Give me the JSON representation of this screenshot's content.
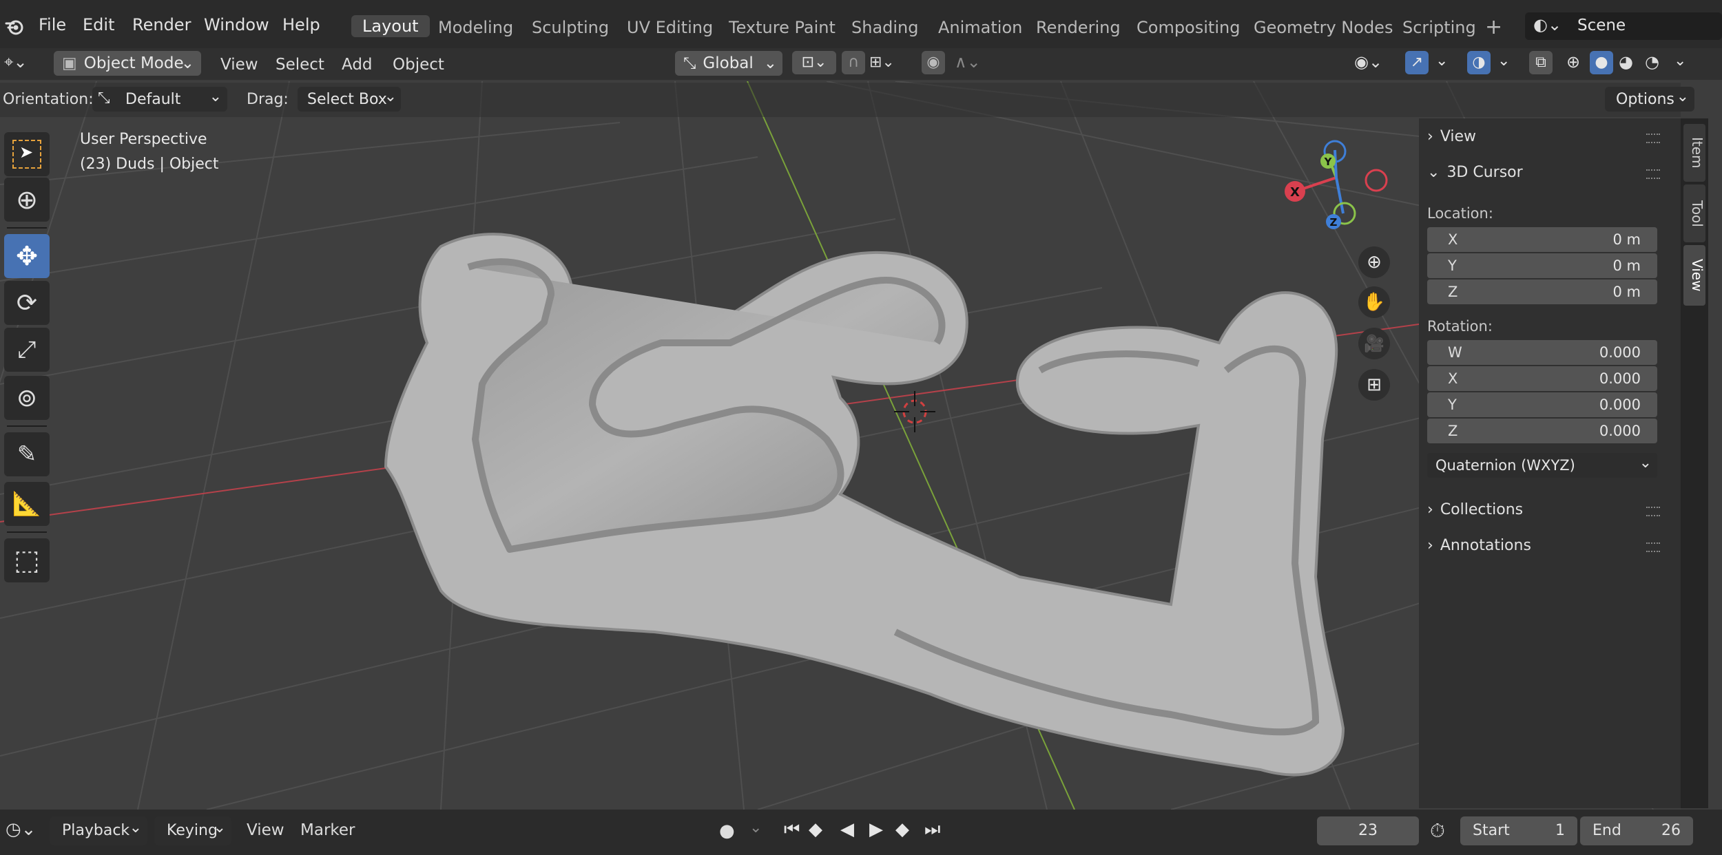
{
  "topbar": {
    "menus": [
      "File",
      "Edit",
      "Render",
      "Window",
      "Help"
    ],
    "workspaces": [
      "Layout",
      "Modeling",
      "Sculpting",
      "UV Editing",
      "Texture Paint",
      "Shading",
      "Animation",
      "Rendering",
      "Compositing",
      "Geometry Nodes",
      "Scripting"
    ],
    "active_workspace": "Layout",
    "add_tab": "+",
    "scene": "Scene"
  },
  "header": {
    "mode": "Object Mode",
    "menus": [
      "View",
      "Select",
      "Add",
      "Object"
    ],
    "transform_orientation": "Global"
  },
  "tool_settings": {
    "orientation_label": "Orientation:",
    "orientation_value": "Default",
    "drag_label": "Drag:",
    "drag_value": "Select Box",
    "options": "Options"
  },
  "viewport": {
    "perspective": "User Perspective",
    "object_info": "(23) Duds | Object",
    "gizmo": {
      "x": "X",
      "y": "Y",
      "z": "Z"
    }
  },
  "npanel": {
    "view_section": "View",
    "cursor_section": "3D Cursor",
    "location_label": "Location:",
    "location": [
      {
        "axis": "X",
        "value": "0 m"
      },
      {
        "axis": "Y",
        "value": "0 m"
      },
      {
        "axis": "Z",
        "value": "0 m"
      }
    ],
    "rotation_label": "Rotation:",
    "rotation": [
      {
        "axis": "W",
        "value": "0.000"
      },
      {
        "axis": "X",
        "value": "0.000"
      },
      {
        "axis": "Y",
        "value": "0.000"
      },
      {
        "axis": "Z",
        "value": "0.000"
      }
    ],
    "rotation_mode": "Quaternion (WXYZ)",
    "collections_section": "Collections",
    "annotations_section": "Annotations",
    "tabs": [
      "Item",
      "Tool",
      "View"
    ],
    "active_tab": "View"
  },
  "timeline": {
    "menus": [
      "Playback",
      "Keying",
      "View",
      "Marker"
    ],
    "current_frame": "23",
    "start_label": "Start",
    "start_value": "1",
    "end_label": "End",
    "end_value": "26"
  },
  "colors": {
    "accent": "#4772b3",
    "x_axis": "#d9404f",
    "y_axis": "#8bc34a",
    "z_axis": "#3f7fd8"
  }
}
